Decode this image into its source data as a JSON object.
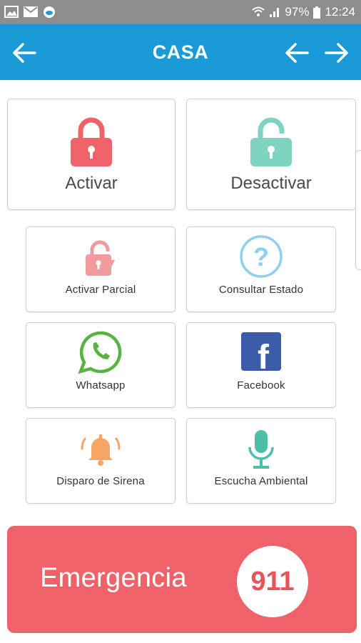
{
  "statusbar": {
    "battery": "97%",
    "time": "12:24"
  },
  "appbar": {
    "title": "CASA"
  },
  "main_actions": [
    {
      "label": "Activar",
      "color": "#f0626a"
    },
    {
      "label": "Desactivar",
      "color": "#7fd3c0"
    }
  ],
  "options": [
    {
      "label": "Activar Parcial",
      "icon": "padlock-partial-icon",
      "color": "#f29b9f"
    },
    {
      "label": "Consultar Estado",
      "icon": "question-icon",
      "color": "#8fd0f0"
    },
    {
      "label": "Whatsapp",
      "icon": "whatsapp-icon",
      "color": "#57b443"
    },
    {
      "label": "Facebook",
      "icon": "facebook-icon",
      "color": "#3b5ca8"
    },
    {
      "label": "Disparo de Sirena",
      "icon": "bell-icon",
      "color": "#f7a565"
    },
    {
      "label": "Escucha Ambiental",
      "icon": "microphone-icon",
      "color": "#4cbfa8"
    }
  ],
  "emergency": {
    "label": "Emergencia",
    "number": "911",
    "color": "#f0626a"
  }
}
